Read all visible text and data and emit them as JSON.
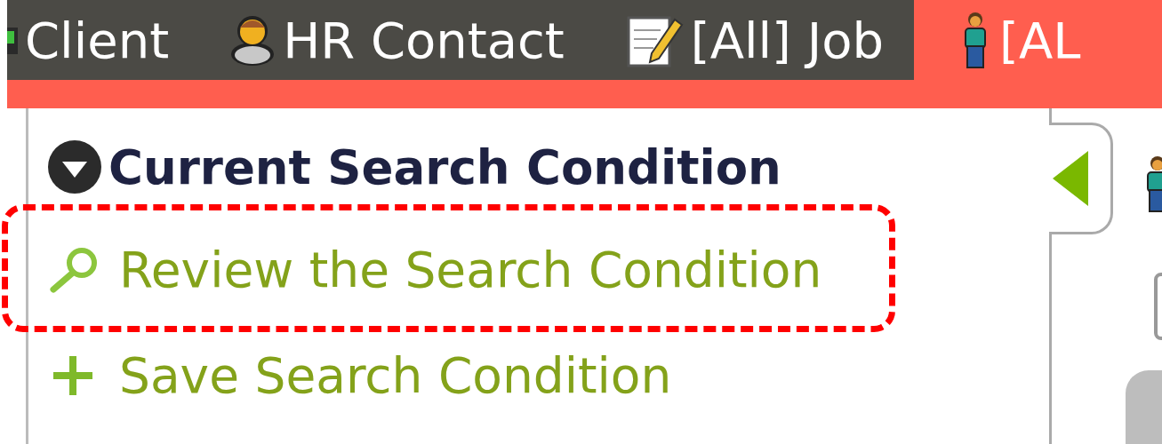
{
  "tabs": [
    {
      "label": "Client",
      "kind": "cut",
      "selected": false
    },
    {
      "label": "HR Contact",
      "kind": "bust",
      "selected": false
    },
    {
      "label": "[All] Job",
      "kind": "notepad",
      "selected": false
    },
    {
      "label": "[AL",
      "kind": "figure",
      "selected": true
    }
  ],
  "panel": {
    "title": "Current Search Condition",
    "expanded": true,
    "links": [
      {
        "label": "Review the Search Condition",
        "kind": "search",
        "highlighted": true
      },
      {
        "label": "Save Search Condition",
        "kind": "plus",
        "highlighted": false
      }
    ]
  }
}
